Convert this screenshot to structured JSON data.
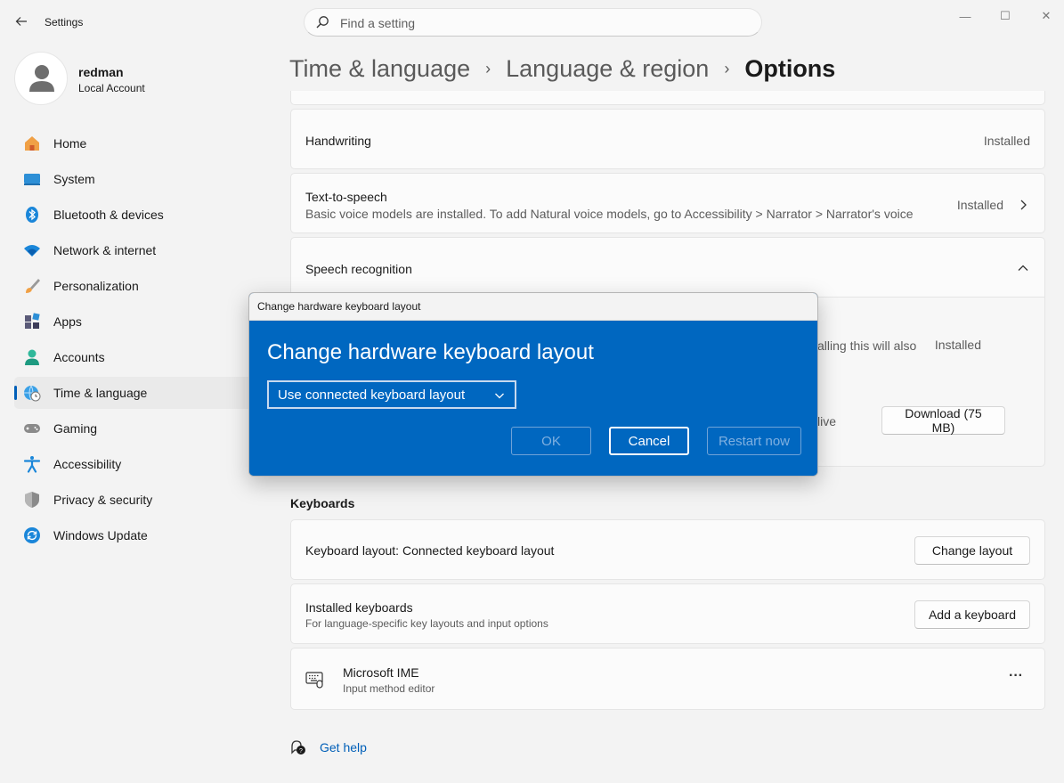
{
  "window": {
    "app_title": "Settings",
    "controls": {
      "minimize": "—",
      "maximize": "☐",
      "close": "✕"
    }
  },
  "search": {
    "placeholder": "Find a setting",
    "value": ""
  },
  "user": {
    "name": "redman",
    "account_type": "Local Account"
  },
  "nav": {
    "items": [
      {
        "label": "Home",
        "icon": "home-icon"
      },
      {
        "label": "System",
        "icon": "system-icon"
      },
      {
        "label": "Bluetooth & devices",
        "icon": "bluetooth-icon"
      },
      {
        "label": "Network & internet",
        "icon": "wifi-icon"
      },
      {
        "label": "Personalization",
        "icon": "brush-icon"
      },
      {
        "label": "Apps",
        "icon": "apps-icon"
      },
      {
        "label": "Accounts",
        "icon": "accounts-icon"
      },
      {
        "label": "Time & language",
        "icon": "globe-clock-icon",
        "active": true
      },
      {
        "label": "Gaming",
        "icon": "gamepad-icon"
      },
      {
        "label": "Accessibility",
        "icon": "accessibility-icon"
      },
      {
        "label": "Privacy & security",
        "icon": "shield-icon"
      },
      {
        "label": "Windows Update",
        "icon": "update-icon"
      }
    ]
  },
  "breadcrumb": {
    "items": [
      "Time & language",
      "Language & region"
    ],
    "current": "Options",
    "separator": "›"
  },
  "content": {
    "handwriting": {
      "title": "Handwriting",
      "status": "Installed"
    },
    "tts": {
      "title": "Text-to-speech",
      "subtitle": "Basic voice models are installed. To add Natural voice models, go to Accessibility > Narrator > Narrator's voice",
      "status": "Installed"
    },
    "speech": {
      "title": "Speech recognition",
      "partial_text": "alling this will also",
      "status": "Installed",
      "partial_text_2": "live",
      "download_label": "Download (75 MB)"
    },
    "keyboards": {
      "section_title": "Keyboards",
      "layout_title": "Keyboard layout: Connected keyboard layout",
      "change_layout_label": "Change layout",
      "installed_title": "Installed keyboards",
      "installed_sub": "For language-specific key layouts and input options",
      "add_keyboard_label": "Add a keyboard",
      "ime_title": "Microsoft IME",
      "ime_sub": "Input method editor",
      "more_label": "···"
    },
    "help_label": "Get help"
  },
  "dialog": {
    "window_title": "Change hardware keyboard layout",
    "heading": "Change hardware keyboard layout",
    "select_value": "Use connected keyboard layout",
    "ok_label": "OK",
    "cancel_label": "Cancel",
    "restart_label": "Restart now"
  },
  "colors": {
    "accent": "#005fb8",
    "dialog_bg": "#0067c0",
    "window_bg": "#f3f3f3",
    "card_bg": "#fbfbfb"
  }
}
